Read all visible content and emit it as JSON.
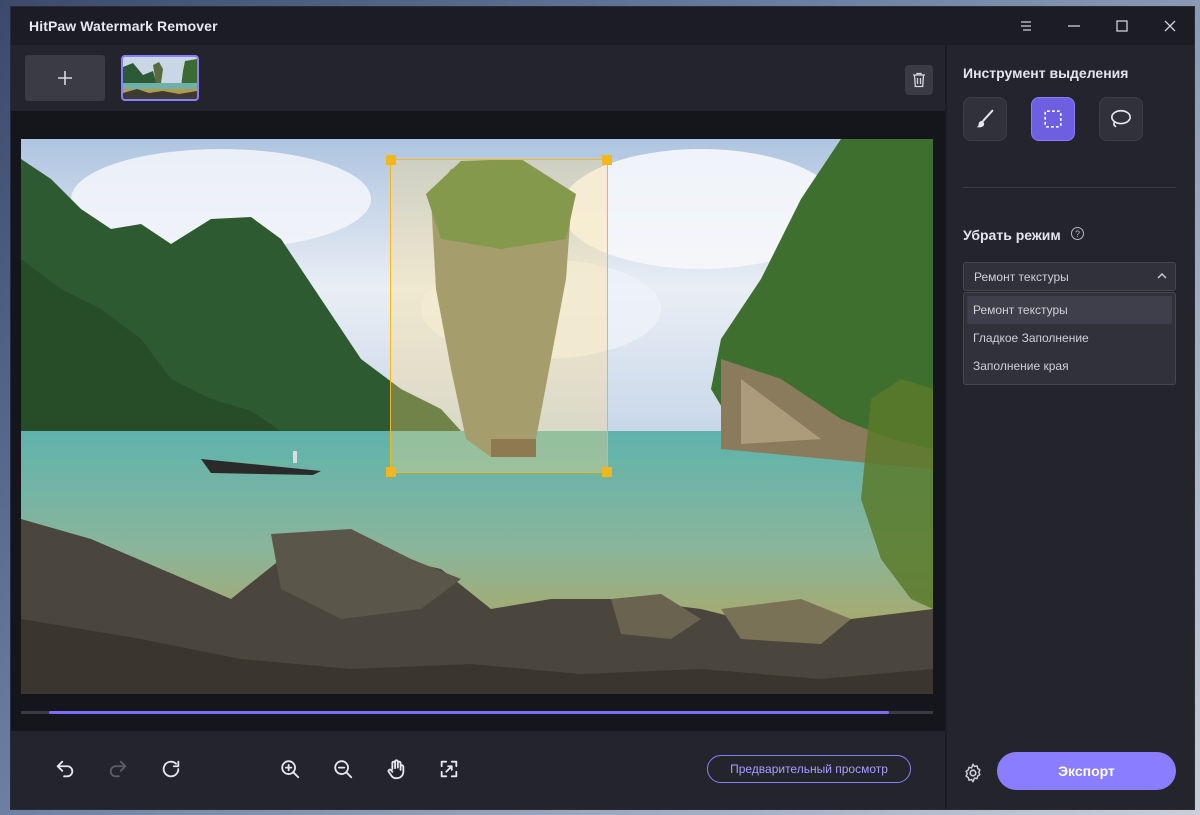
{
  "window": {
    "title": "HitPaw Watermark Remover",
    "controls": [
      "menu-icon",
      "minimize-icon",
      "maximize-icon",
      "close-icon"
    ]
  },
  "thumbnails": {
    "add_icon": "plus-icon",
    "delete_icon": "trash-icon"
  },
  "canvas": {
    "timeline_progress": 0.95
  },
  "toolbar": {
    "tools": [
      "undo-icon",
      "redo-icon",
      "refresh-icon",
      "zoom-in-icon",
      "zoom-out-icon",
      "hand-icon",
      "fit-screen-icon"
    ],
    "preview_label": "Предварительный просмотр"
  },
  "right_panel": {
    "selection_tool_title": "Инструмент выделения",
    "selection_tools": [
      "brush-icon",
      "rectangle-select-icon",
      "lasso-icon"
    ],
    "active_tool": "rectangle-select-icon",
    "remove_mode_title": "Убрать режим",
    "remove_mode_selected": "Ремонт текстуры",
    "remove_mode_options": [
      "Ремонт текстуры",
      "Гладкое Заполнение",
      "Заполнение края"
    ],
    "export_label": "Экспорт"
  },
  "colors": {
    "accent": "#8a7dff",
    "selection": "#f5b61c",
    "panel_bg": "#23242c"
  }
}
